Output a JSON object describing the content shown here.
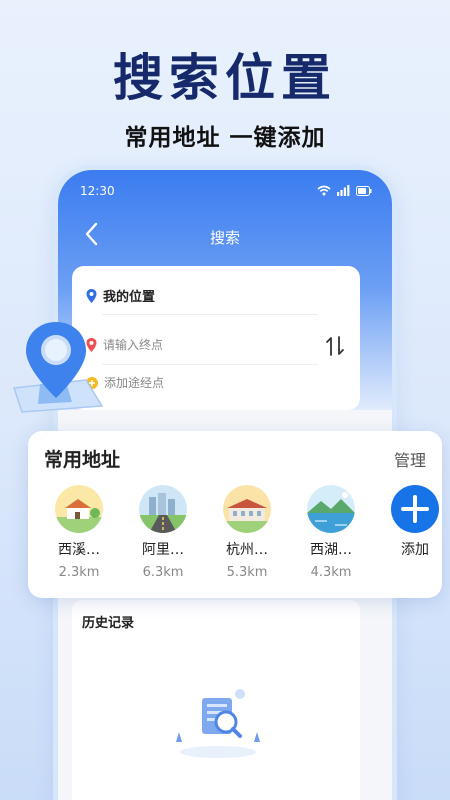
{
  "promo": {
    "headline": "搜索位置",
    "subline": "常用地址 一键添加"
  },
  "status_bar": {
    "time": "12:30",
    "icons": [
      "wifi-icon",
      "signal-icon",
      "battery-icon"
    ]
  },
  "nav": {
    "title": "搜索",
    "back_icon": "chevron-left-icon"
  },
  "search": {
    "origin_label": "我的位置",
    "destination_placeholder": "请输入终点",
    "waypoint_label": "添加途经点",
    "swap_icon": "swap-icon"
  },
  "favorites": {
    "title": "常用地址",
    "manage_label": "管理",
    "items": [
      {
        "name": "西溪…",
        "distance": "2.3km",
        "icon": "house-thumbnail"
      },
      {
        "name": "阿里…",
        "distance": "6.3km",
        "icon": "city-road-thumbnail"
      },
      {
        "name": "杭州…",
        "distance": "5.3km",
        "icon": "building-thumbnail"
      },
      {
        "name": "西湖…",
        "distance": "4.3km",
        "icon": "lake-thumbnail"
      }
    ],
    "add_label": "添加"
  },
  "history": {
    "title": "历史记录"
  },
  "colors": {
    "accent": "#1774e6",
    "headline": "#162a6b",
    "origin_dot": "#2f6fe0",
    "destination_dot": "#f05050",
    "waypoint_dot": "#f5b820"
  }
}
